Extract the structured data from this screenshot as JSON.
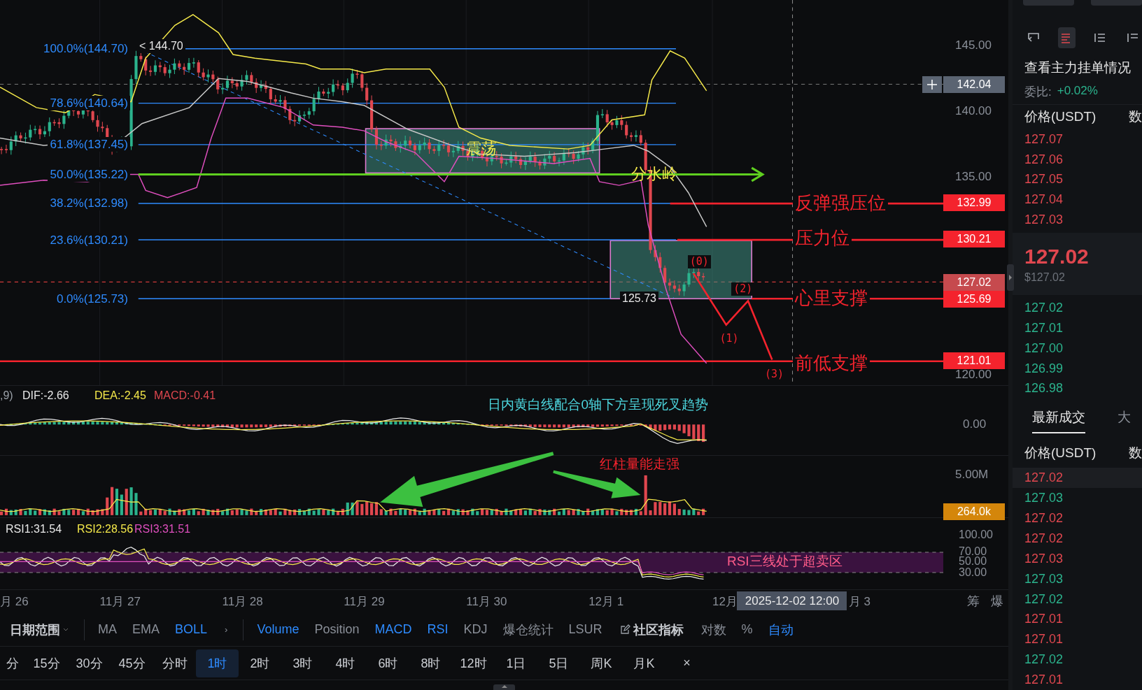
{
  "main_chart": {
    "fib_levels": [
      "100.0%(144.70)",
      "78.6%(140.64)",
      "61.8%(137.45)",
      "50.0%(135.22)",
      "38.2%(132.98)",
      "23.6%(130.21)",
      "0.0%(125.73)"
    ],
    "high_marker": "< 144.70",
    "low_marker": "125.73",
    "annotations": [
      {
        "text": "震荡",
        "color": "#f5e94a"
      },
      {
        "text": "分水岭",
        "color": "#f5e94a"
      },
      {
        "text": "反弹强压位",
        "color": "#f4232d"
      },
      {
        "text": "压力位",
        "color": "#f4232d"
      },
      {
        "text": "心里支撑",
        "color": "#f4232d"
      },
      {
        "text": "前低支撑",
        "color": "#f4232d"
      }
    ],
    "wave_labels": [
      "(0)",
      "(1)",
      "(2)",
      "(3)"
    ],
    "axis_ticks": [
      "145.00",
      "140.00",
      "135.00",
      "120.00"
    ],
    "price_tags": [
      {
        "text": "142.04",
        "kind": "crosshair"
      },
      {
        "text": "132.99",
        "kind": "level"
      },
      {
        "text": "130.21",
        "kind": "level"
      },
      {
        "text": "127.02",
        "kind": "last"
      },
      {
        "text": "125.69",
        "kind": "level"
      },
      {
        "text": "121.01",
        "kind": "level"
      }
    ]
  },
  "macd": {
    "legend": [
      {
        "text": ",9)",
        "color": "#9aa0a8"
      },
      {
        "text": "DIF:-2.66",
        "color": "#e8e8e8"
      },
      {
        "text": "DEA:-2.45",
        "color": "#f5e94a"
      },
      {
        "text": "MACD:-0.41",
        "color": "#e0474f"
      }
    ],
    "note": "日内黄白线配合0轴下方呈现死叉趋势",
    "axis_ticks": [
      "0.00"
    ]
  },
  "volume": {
    "note": "红柱量能走强",
    "axis_ticks": [
      "5.00M"
    ],
    "tag": "264.0k"
  },
  "rsi": {
    "legend": [
      {
        "text": "RSI1:31.54",
        "color": "#e8e8e8"
      },
      {
        "text": "RSI2:28.56",
        "color": "#f5e94a"
      },
      {
        "text": "RSI3:31.51",
        "color": "#e04fbf"
      }
    ],
    "note": "RSI三线处于超卖区",
    "axis_ticks": [
      "100.00",
      "70.00",
      "50.00",
      "30.00"
    ]
  },
  "time_axis": {
    "labels": [
      "月 26",
      "11月 27",
      "11月 28",
      "11月 29",
      "11月 30",
      "12月 1",
      "12月",
      "月 3"
    ],
    "crosshair": "2025-12-02 12:00",
    "extras": [
      "筹",
      "爆"
    ]
  },
  "indicator_bar": [
    {
      "label": "日期范围",
      "kind": "menu",
      "selected": false
    },
    {
      "label": "MA",
      "kind": "item",
      "selected": false
    },
    {
      "label": "EMA",
      "kind": "item",
      "selected": false
    },
    {
      "label": "BOLL",
      "kind": "item",
      "selected": true
    },
    {
      "label": "›",
      "kind": "more",
      "selected": false
    },
    {
      "label": "Volume",
      "kind": "item",
      "selected": true
    },
    {
      "label": "Position",
      "kind": "item",
      "selected": false
    },
    {
      "label": "MACD",
      "kind": "item",
      "selected": true
    },
    {
      "label": "RSI",
      "kind": "item",
      "selected": true
    },
    {
      "label": "KDJ",
      "kind": "item",
      "selected": false
    },
    {
      "label": "爆仓统计",
      "kind": "item",
      "selected": false
    },
    {
      "label": "LSUR",
      "kind": "item",
      "selected": false
    },
    {
      "label": "社区指标",
      "kind": "community",
      "selected": false
    },
    {
      "label": "对数",
      "kind": "item",
      "selected": false
    },
    {
      "label": "%",
      "kind": "item",
      "selected": false
    },
    {
      "label": "自动",
      "kind": "item",
      "selected": true
    }
  ],
  "intervals": [
    {
      "label": "分",
      "selected": false
    },
    {
      "label": "15分",
      "selected": false
    },
    {
      "label": "30分",
      "selected": false
    },
    {
      "label": "45分",
      "selected": false
    },
    {
      "label": "分时",
      "selected": false
    },
    {
      "label": "1时",
      "selected": true
    },
    {
      "label": "2时",
      "selected": false
    },
    {
      "label": "3时",
      "selected": false
    },
    {
      "label": "4时",
      "selected": false
    },
    {
      "label": "6时",
      "selected": false
    },
    {
      "label": "8时",
      "selected": false
    },
    {
      "label": "12时",
      "selected": false
    },
    {
      "label": "1日",
      "selected": false
    },
    {
      "label": "5日",
      "selected": false
    },
    {
      "label": "周K",
      "selected": false
    },
    {
      "label": "月K",
      "selected": false
    },
    {
      "label": "×",
      "selected": false
    }
  ],
  "order_book": {
    "title": "查看主力挂单情况",
    "ratio_label": "委比:",
    "ratio_value": "+0.02%",
    "columns": [
      "价格(USDT)",
      "数"
    ],
    "asks": [
      "127.07",
      "127.06",
      "127.05",
      "127.04",
      "127.03"
    ],
    "mid_price": "127.02",
    "mid_usd": "$127.02",
    "bids": [
      "127.02",
      "127.01",
      "127.00",
      "126.99",
      "126.98"
    ],
    "tabs": [
      {
        "label": "最新成交",
        "selected": true
      },
      {
        "label": "大",
        "selected": false
      }
    ],
    "trade_columns": [
      "价格(USDT)",
      "数"
    ],
    "trades": [
      {
        "price": "127.02",
        "kind": "sell"
      },
      {
        "price": "127.03",
        "kind": "buy"
      },
      {
        "price": "127.02",
        "kind": "sell"
      },
      {
        "price": "127.02",
        "kind": "sell"
      },
      {
        "price": "127.03",
        "kind": "sell"
      },
      {
        "price": "127.03",
        "kind": "buy"
      },
      {
        "price": "127.02",
        "kind": "buy"
      },
      {
        "price": "127.01",
        "kind": "sell"
      },
      {
        "price": "127.01",
        "kind": "sell"
      },
      {
        "price": "127.02",
        "kind": "buy"
      },
      {
        "price": "127.01",
        "kind": "sell"
      }
    ]
  }
}
